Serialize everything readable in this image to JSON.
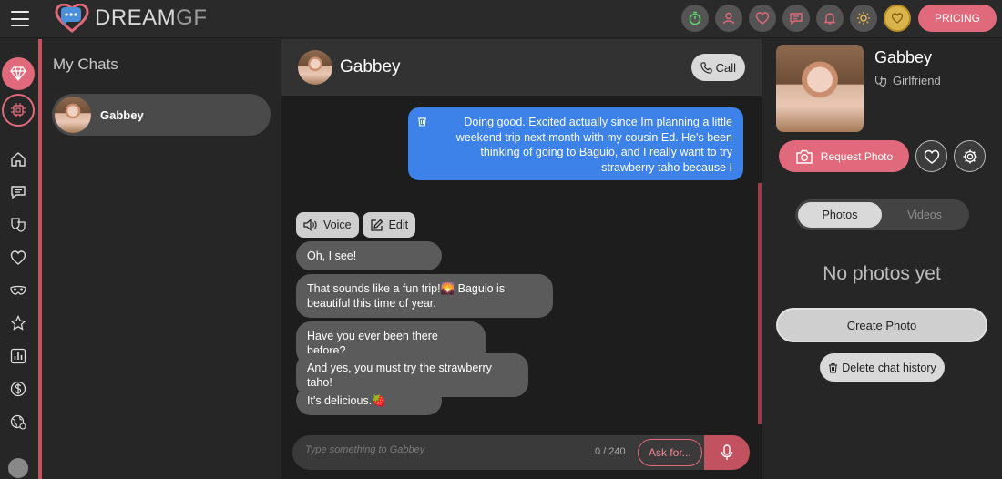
{
  "app": {
    "name_left": "DREAM",
    "name_right": "GF",
    "pricing_label": "PRICING"
  },
  "top_icons": [
    "timer-icon",
    "user-icon",
    "heart-icon",
    "chat-icon",
    "bell-icon",
    "sun-icon",
    "gold-heart-coin-icon"
  ],
  "sidebar": {
    "items": [
      "diamond-icon",
      "chip-icon",
      "home-icon",
      "chat-icon",
      "masks-icon",
      "heart-icon",
      "mask-icon",
      "star-icon",
      "stats-icon",
      "dollar-icon",
      "globe-icon",
      "profile-avatar"
    ]
  },
  "chat_list": {
    "title": "My Chats",
    "entries": [
      {
        "name": "Gabbey"
      }
    ]
  },
  "conversation": {
    "name": "Gabbey",
    "call_label": "Call",
    "user_message": "Doing good. Excited actually since Im planning a little weekend trip next month with my cousin Ed. He's been thinking of going to Baguio, and I really want to try strawberry taho because I",
    "actions": {
      "voice_label": "Voice",
      "edit_label": "Edit"
    },
    "bot_messages": [
      "Oh, I see!",
      "That sounds like a fun trip!🌄 Baguio is beautiful this time of year.",
      "Have you ever been there before?",
      "And yes, you must try the strawberry taho!",
      "It's delicious.🍓"
    ],
    "input": {
      "placeholder": "Type something to Gabbey",
      "counter": "0 / 240",
      "ask_label": "Ask for..."
    }
  },
  "profile": {
    "name": "Gabbey",
    "role": "Girlfriend",
    "request_photo_label": "Request Photo",
    "tabs": {
      "photos": "Photos",
      "videos": "Videos"
    },
    "empty_text": "No photos yet",
    "create_photo_label": "Create Photo",
    "delete_history_label": "Delete chat history"
  },
  "colors": {
    "accent": "#e06a7b",
    "user_bubble": "#3d82e8",
    "bot_bubble": "#5b5b5b"
  }
}
